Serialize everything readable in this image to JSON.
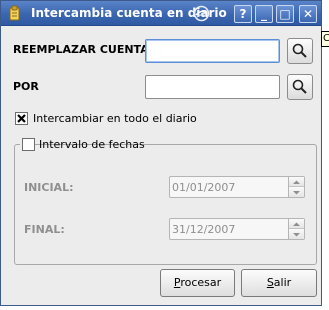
{
  "window": {
    "title": "Intercambia cuenta en diario",
    "controls": {
      "help": "?",
      "minimize": "_",
      "maximize": "□",
      "close": "✕"
    }
  },
  "tooltip_fragment": "C",
  "form": {
    "replace_label": "REEMPLAZAR CUENTA",
    "replace_value": "",
    "by_label": "POR",
    "by_value": "",
    "search_icon": "magnifier-icon",
    "whole_journal": {
      "label": "Intercambiar en todo el diario",
      "checked": true
    },
    "date_range": {
      "label": "Intervalo de fechas",
      "checked": false,
      "start_label": "INICIAL:",
      "start_value": "01/01/2007",
      "end_label": "FINAL:",
      "end_value": "31/12/2007"
    }
  },
  "buttons": {
    "process": {
      "mnemonic": "P",
      "rest": "rocesar"
    },
    "exit": {
      "mnemonic": "S",
      "rest": "alir"
    }
  },
  "colors": {
    "titlebar": "#3b66b0",
    "focus": "#5b8ed6",
    "dialog_bg": "#ececec"
  }
}
